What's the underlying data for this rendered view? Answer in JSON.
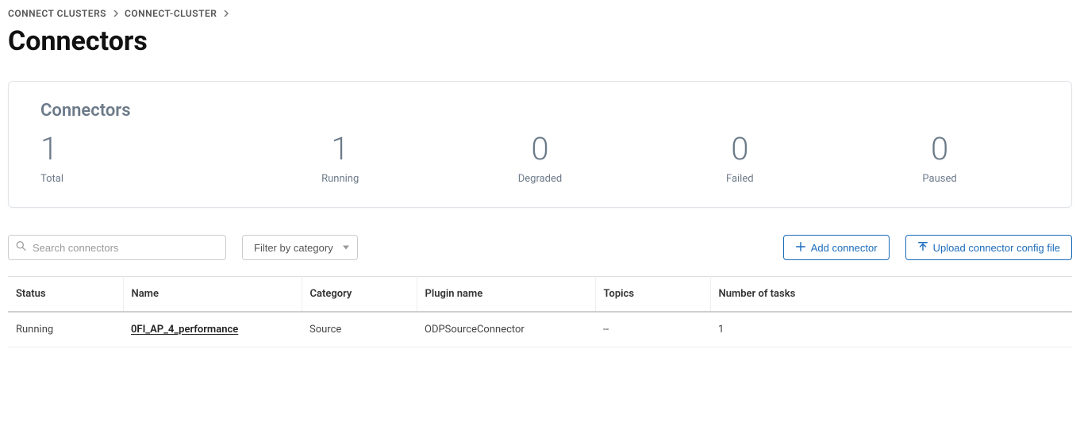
{
  "breadcrumb": {
    "crumb1": "CONNECT CLUSTERS",
    "crumb2": "CONNECT-CLUSTER"
  },
  "page_title": "Connectors",
  "summary": {
    "title": "Connectors",
    "stats": [
      {
        "value": "1",
        "label": "Total"
      },
      {
        "value": "1",
        "label": "Running"
      },
      {
        "value": "0",
        "label": "Degraded"
      },
      {
        "value": "0",
        "label": "Failed"
      },
      {
        "value": "0",
        "label": "Paused"
      }
    ]
  },
  "toolbar": {
    "search_placeholder": "Search connectors",
    "filter_label": "Filter by category",
    "add_label": "Add connector",
    "upload_label": "Upload connector config file"
  },
  "table": {
    "headers": {
      "status": "Status",
      "name": "Name",
      "category": "Category",
      "plugin": "Plugin name",
      "topics": "Topics",
      "tasks": "Number of tasks"
    },
    "rows": [
      {
        "status": "Running",
        "name": "0FI_AP_4_performance",
        "category": "Source",
        "plugin": "ODPSourceConnector",
        "topics": "--",
        "tasks": "1"
      }
    ]
  }
}
